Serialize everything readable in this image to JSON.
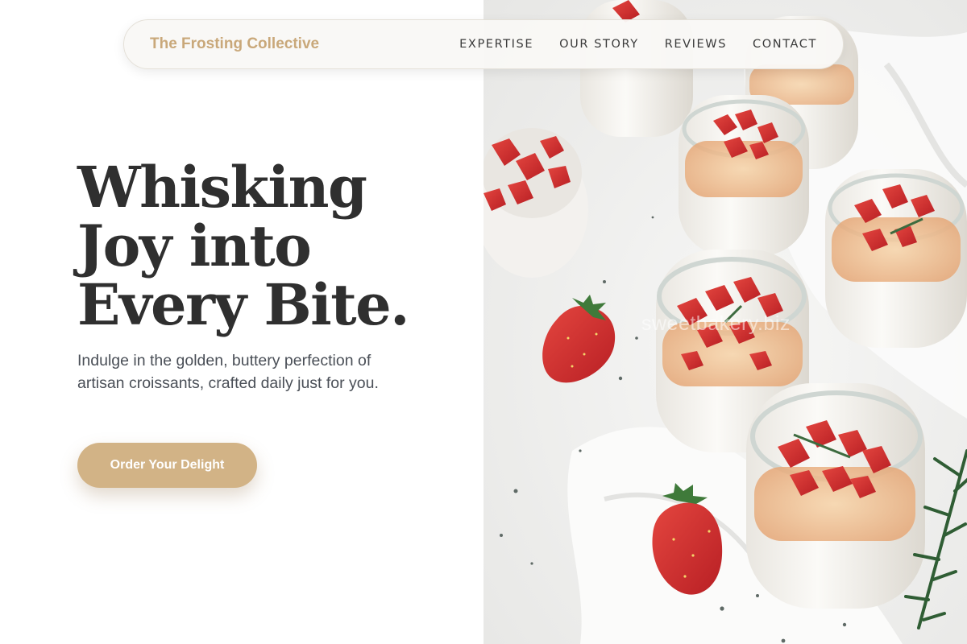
{
  "navbar": {
    "brand": "The Frosting Collective",
    "links": [
      "EXPERTISE",
      "OUR STORY",
      "REVIEWS",
      "CONTACT"
    ]
  },
  "hero": {
    "headline_lines": [
      "Whisking",
      "Joy into",
      "Every Bite."
    ],
    "subtext": "Indulge in the golden, buttery perfection of artisan croissants, crafted daily just for you.",
    "cta_label": "Order Your Delight"
  },
  "photo": {
    "watermark": "sweetbakery.biz",
    "alt": "Jars of panna cotta topped with chopped strawberries"
  },
  "colors": {
    "accent": "#d2b386",
    "brand_text": "#c9a87a",
    "headline": "#2f2f2f",
    "body_text": "#4a4f57"
  }
}
